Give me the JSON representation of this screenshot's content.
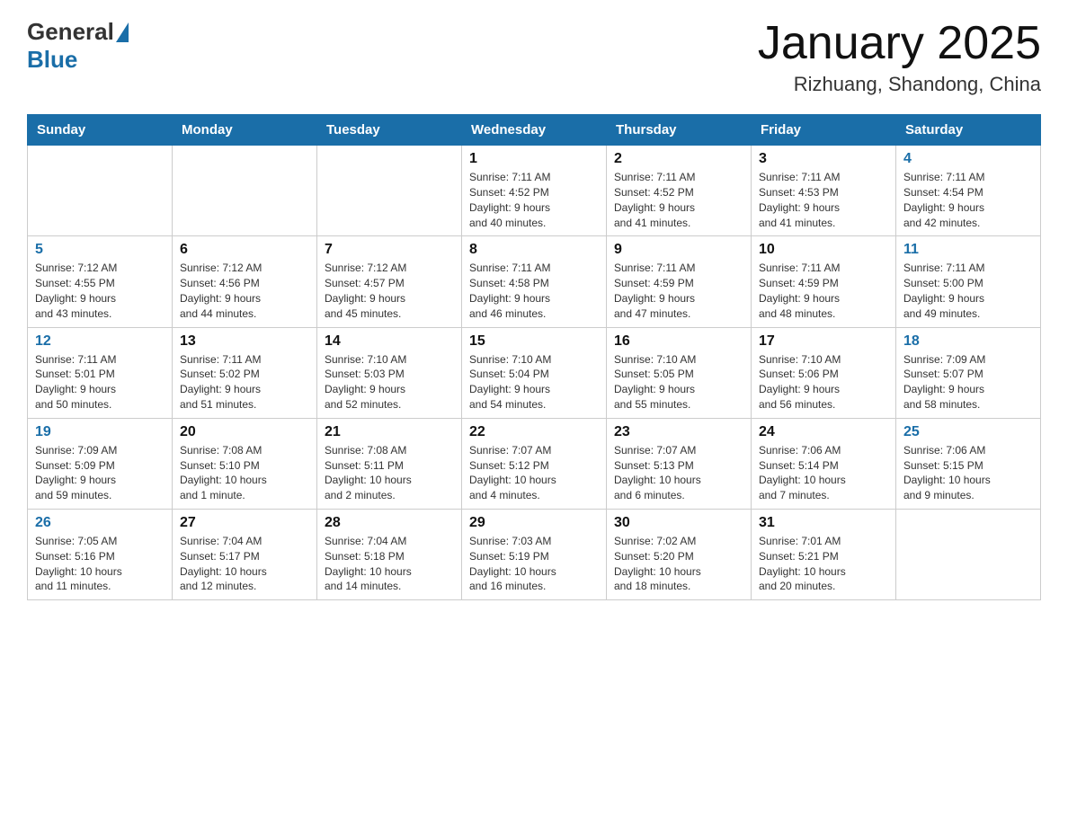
{
  "header": {
    "logo_general": "General",
    "logo_blue": "Blue",
    "title": "January 2025",
    "location": "Rizhuang, Shandong, China"
  },
  "weekdays": [
    "Sunday",
    "Monday",
    "Tuesday",
    "Wednesday",
    "Thursday",
    "Friday",
    "Saturday"
  ],
  "weeks": [
    [
      {
        "day": "",
        "info": ""
      },
      {
        "day": "",
        "info": ""
      },
      {
        "day": "",
        "info": ""
      },
      {
        "day": "1",
        "info": "Sunrise: 7:11 AM\nSunset: 4:52 PM\nDaylight: 9 hours\nand 40 minutes."
      },
      {
        "day": "2",
        "info": "Sunrise: 7:11 AM\nSunset: 4:52 PM\nDaylight: 9 hours\nand 41 minutes."
      },
      {
        "day": "3",
        "info": "Sunrise: 7:11 AM\nSunset: 4:53 PM\nDaylight: 9 hours\nand 41 minutes."
      },
      {
        "day": "4",
        "info": "Sunrise: 7:11 AM\nSunset: 4:54 PM\nDaylight: 9 hours\nand 42 minutes."
      }
    ],
    [
      {
        "day": "5",
        "info": "Sunrise: 7:12 AM\nSunset: 4:55 PM\nDaylight: 9 hours\nand 43 minutes."
      },
      {
        "day": "6",
        "info": "Sunrise: 7:12 AM\nSunset: 4:56 PM\nDaylight: 9 hours\nand 44 minutes."
      },
      {
        "day": "7",
        "info": "Sunrise: 7:12 AM\nSunset: 4:57 PM\nDaylight: 9 hours\nand 45 minutes."
      },
      {
        "day": "8",
        "info": "Sunrise: 7:11 AM\nSunset: 4:58 PM\nDaylight: 9 hours\nand 46 minutes."
      },
      {
        "day": "9",
        "info": "Sunrise: 7:11 AM\nSunset: 4:59 PM\nDaylight: 9 hours\nand 47 minutes."
      },
      {
        "day": "10",
        "info": "Sunrise: 7:11 AM\nSunset: 4:59 PM\nDaylight: 9 hours\nand 48 minutes."
      },
      {
        "day": "11",
        "info": "Sunrise: 7:11 AM\nSunset: 5:00 PM\nDaylight: 9 hours\nand 49 minutes."
      }
    ],
    [
      {
        "day": "12",
        "info": "Sunrise: 7:11 AM\nSunset: 5:01 PM\nDaylight: 9 hours\nand 50 minutes."
      },
      {
        "day": "13",
        "info": "Sunrise: 7:11 AM\nSunset: 5:02 PM\nDaylight: 9 hours\nand 51 minutes."
      },
      {
        "day": "14",
        "info": "Sunrise: 7:10 AM\nSunset: 5:03 PM\nDaylight: 9 hours\nand 52 minutes."
      },
      {
        "day": "15",
        "info": "Sunrise: 7:10 AM\nSunset: 5:04 PM\nDaylight: 9 hours\nand 54 minutes."
      },
      {
        "day": "16",
        "info": "Sunrise: 7:10 AM\nSunset: 5:05 PM\nDaylight: 9 hours\nand 55 minutes."
      },
      {
        "day": "17",
        "info": "Sunrise: 7:10 AM\nSunset: 5:06 PM\nDaylight: 9 hours\nand 56 minutes."
      },
      {
        "day": "18",
        "info": "Sunrise: 7:09 AM\nSunset: 5:07 PM\nDaylight: 9 hours\nand 58 minutes."
      }
    ],
    [
      {
        "day": "19",
        "info": "Sunrise: 7:09 AM\nSunset: 5:09 PM\nDaylight: 9 hours\nand 59 minutes."
      },
      {
        "day": "20",
        "info": "Sunrise: 7:08 AM\nSunset: 5:10 PM\nDaylight: 10 hours\nand 1 minute."
      },
      {
        "day": "21",
        "info": "Sunrise: 7:08 AM\nSunset: 5:11 PM\nDaylight: 10 hours\nand 2 minutes."
      },
      {
        "day": "22",
        "info": "Sunrise: 7:07 AM\nSunset: 5:12 PM\nDaylight: 10 hours\nand 4 minutes."
      },
      {
        "day": "23",
        "info": "Sunrise: 7:07 AM\nSunset: 5:13 PM\nDaylight: 10 hours\nand 6 minutes."
      },
      {
        "day": "24",
        "info": "Sunrise: 7:06 AM\nSunset: 5:14 PM\nDaylight: 10 hours\nand 7 minutes."
      },
      {
        "day": "25",
        "info": "Sunrise: 7:06 AM\nSunset: 5:15 PM\nDaylight: 10 hours\nand 9 minutes."
      }
    ],
    [
      {
        "day": "26",
        "info": "Sunrise: 7:05 AM\nSunset: 5:16 PM\nDaylight: 10 hours\nand 11 minutes."
      },
      {
        "day": "27",
        "info": "Sunrise: 7:04 AM\nSunset: 5:17 PM\nDaylight: 10 hours\nand 12 minutes."
      },
      {
        "day": "28",
        "info": "Sunrise: 7:04 AM\nSunset: 5:18 PM\nDaylight: 10 hours\nand 14 minutes."
      },
      {
        "day": "29",
        "info": "Sunrise: 7:03 AM\nSunset: 5:19 PM\nDaylight: 10 hours\nand 16 minutes."
      },
      {
        "day": "30",
        "info": "Sunrise: 7:02 AM\nSunset: 5:20 PM\nDaylight: 10 hours\nand 18 minutes."
      },
      {
        "day": "31",
        "info": "Sunrise: 7:01 AM\nSunset: 5:21 PM\nDaylight: 10 hours\nand 20 minutes."
      },
      {
        "day": "",
        "info": ""
      }
    ]
  ]
}
